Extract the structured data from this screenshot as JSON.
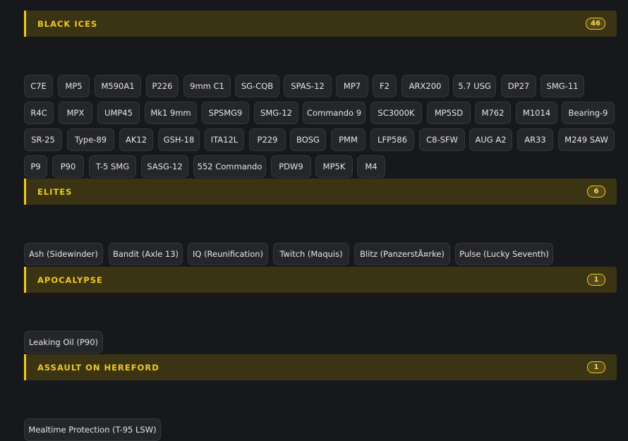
{
  "sections": [
    {
      "title": "BLACK ICES",
      "count": "46",
      "items": [
        "C7E",
        "MP5",
        "M590A1",
        "P226",
        "9mm C1",
        "SG-CQB",
        "SPAS-12",
        "MP7",
        "F2",
        "ARX200",
        "5.7 USG",
        "DP27",
        "SMG-11",
        "R4C",
        "MPX",
        "UMP45",
        "Mk1 9mm",
        "SPSMG9",
        "SMG-12",
        "Commando 9",
        "SC3000K",
        "MP5SD",
        "M762",
        "M1014",
        "Bearing-9",
        "SR-25",
        "Type-89",
        "AK12",
        "GSH-18",
        "ITA12L",
        "P229",
        "BOSG",
        "PMM",
        "LFP586",
        "C8-SFW",
        "AUG A2",
        "AR33",
        "M249 SAW",
        "P9",
        "P90",
        "T-5 SMG",
        "SASG-12",
        "552 Commando",
        "PDW9",
        "MP5K",
        "M4"
      ]
    },
    {
      "title": "ELITES",
      "count": "6",
      "items": [
        "Ash (Sidewinder)",
        "Bandit (Axle 13)",
        "IQ (Reunification)",
        "Twitch (Maquis)",
        "Blitz (PanzerstÃ¤rke)",
        "Pulse (Lucky Seventh)"
      ]
    },
    {
      "title": "APOCALYPSE",
      "count": "1",
      "items": [
        "Leaking Oil (P90)"
      ]
    },
    {
      "title": "ASSAULT ON HEREFORD",
      "count": "1",
      "items": [
        "Mealtime Protection (T-95 LSW)"
      ]
    }
  ]
}
